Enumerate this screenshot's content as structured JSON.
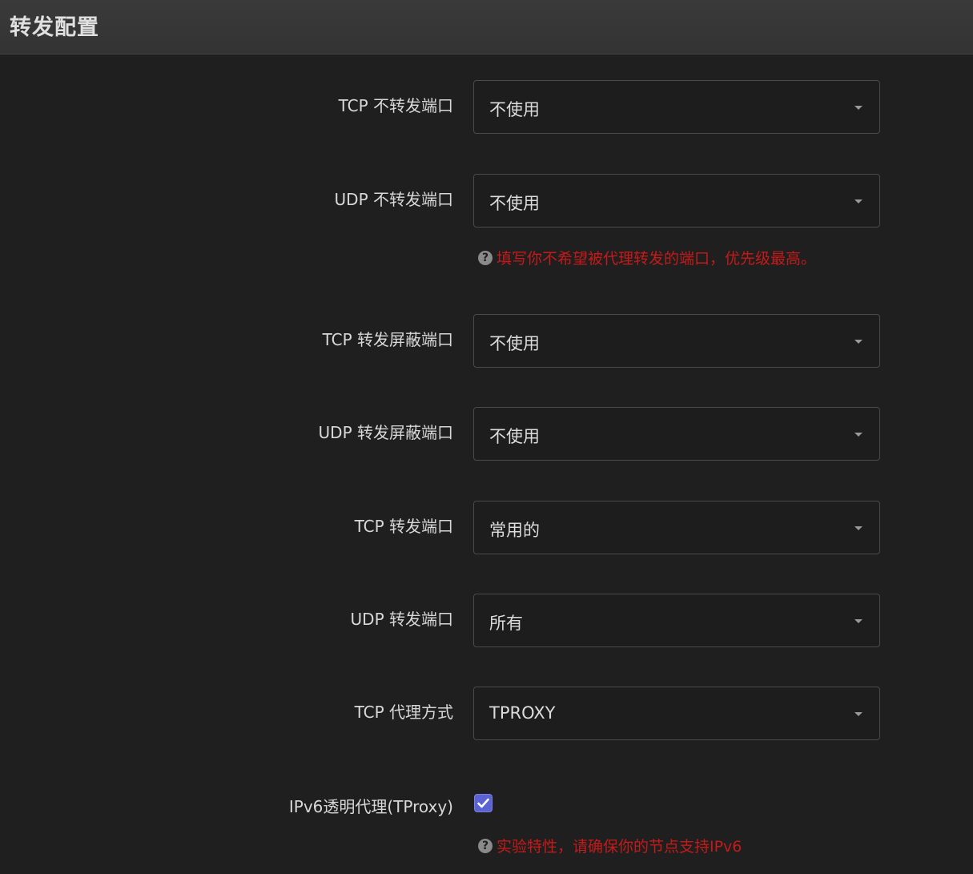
{
  "section": {
    "title": "转发配置"
  },
  "fields": [
    {
      "label": "TCP 不转发端口",
      "value": "不使用"
    },
    {
      "label": "UDP 不转发端口",
      "value": "不使用"
    },
    {
      "label": "TCP 转发屏蔽端口",
      "value": "不使用"
    },
    {
      "label": "UDP 转发屏蔽端口",
      "value": "不使用"
    },
    {
      "label": "TCP 转发端口",
      "value": "常用的"
    },
    {
      "label": "UDP 转发端口",
      "value": "所有"
    },
    {
      "label": "TCP 代理方式",
      "value": "TPROXY"
    }
  ],
  "hints": {
    "no_forward": "填写你不希望被代理转发的端口，优先级最高。",
    "ipv6": "实验特性，请确保你的节点支持IPv6"
  },
  "ipv6": {
    "label": "IPv6透明代理(TProxy)",
    "checked": true
  },
  "colors": {
    "accent": "#5b63d3",
    "hint": "#c41a1a"
  },
  "icons": {
    "hint": "question-circle-icon",
    "select": "chevron-down-icon",
    "check": "check-icon"
  }
}
